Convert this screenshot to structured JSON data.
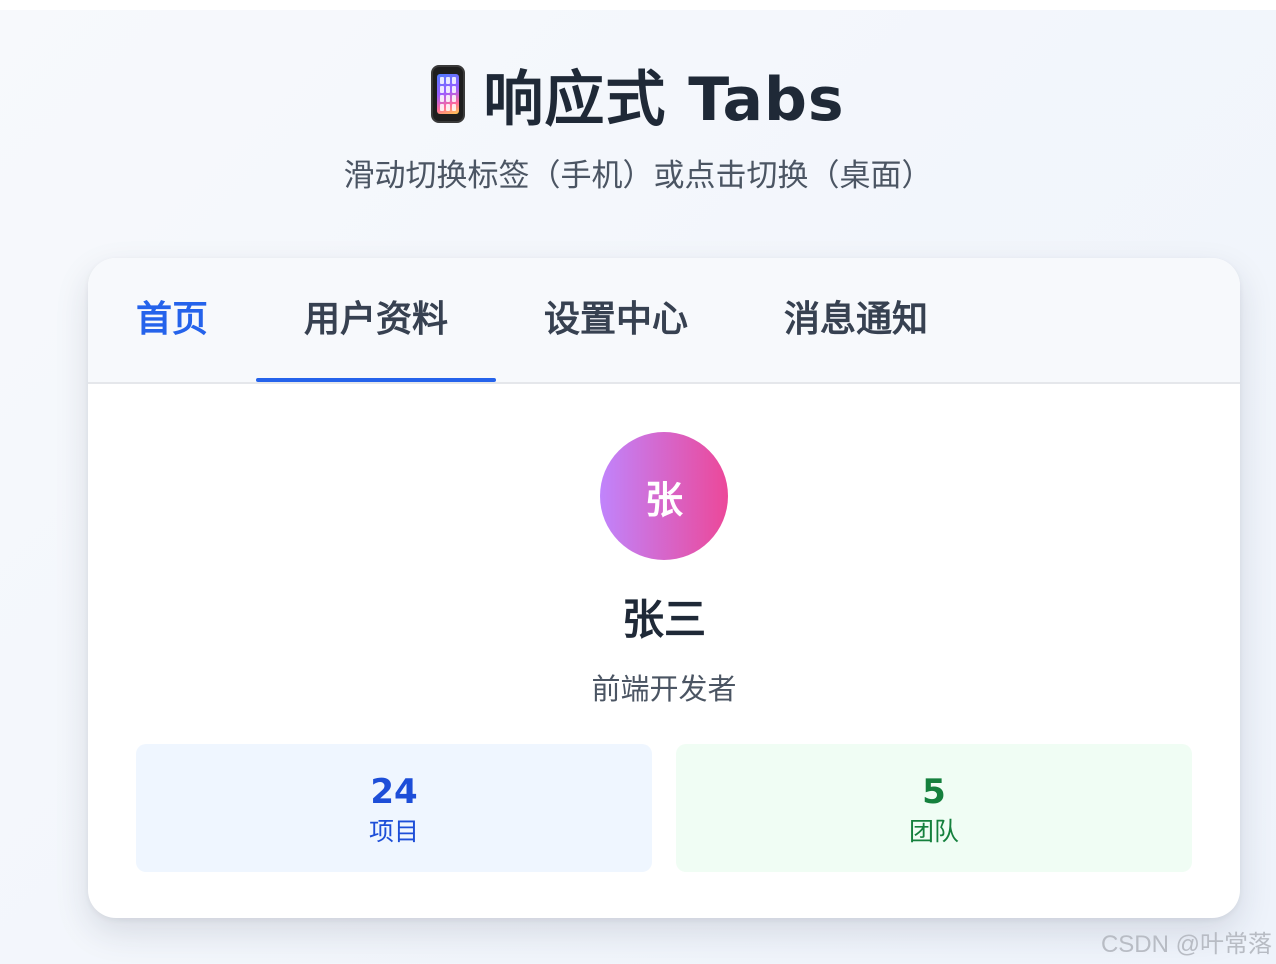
{
  "header": {
    "title": "响应式 Tabs",
    "subtitle": "滑动切换标签（手机）或点击切换（桌面）",
    "icon": "mobile-phone-icon"
  },
  "tabs": [
    {
      "label": "首页",
      "state": "hover"
    },
    {
      "label": "用户资料",
      "state": "active"
    },
    {
      "label": "设置中心",
      "state": "normal"
    },
    {
      "label": "消息通知",
      "state": "normal"
    }
  ],
  "active_tab_index": 1,
  "profile": {
    "avatar_initial": "张",
    "name": "张三",
    "role": "前端开发者"
  },
  "stats": [
    {
      "value": "24",
      "label": "项目",
      "color": "#1d4ed8",
      "bg": "#eff6ff"
    },
    {
      "value": "5",
      "label": "团队",
      "color": "#15803d",
      "bg": "#f0fdf4"
    }
  ],
  "colors": {
    "accent": "#2563eb",
    "avatar_gradient": [
      "#c084fc",
      "#ec4899"
    ]
  },
  "watermark": "CSDN @叶常落"
}
